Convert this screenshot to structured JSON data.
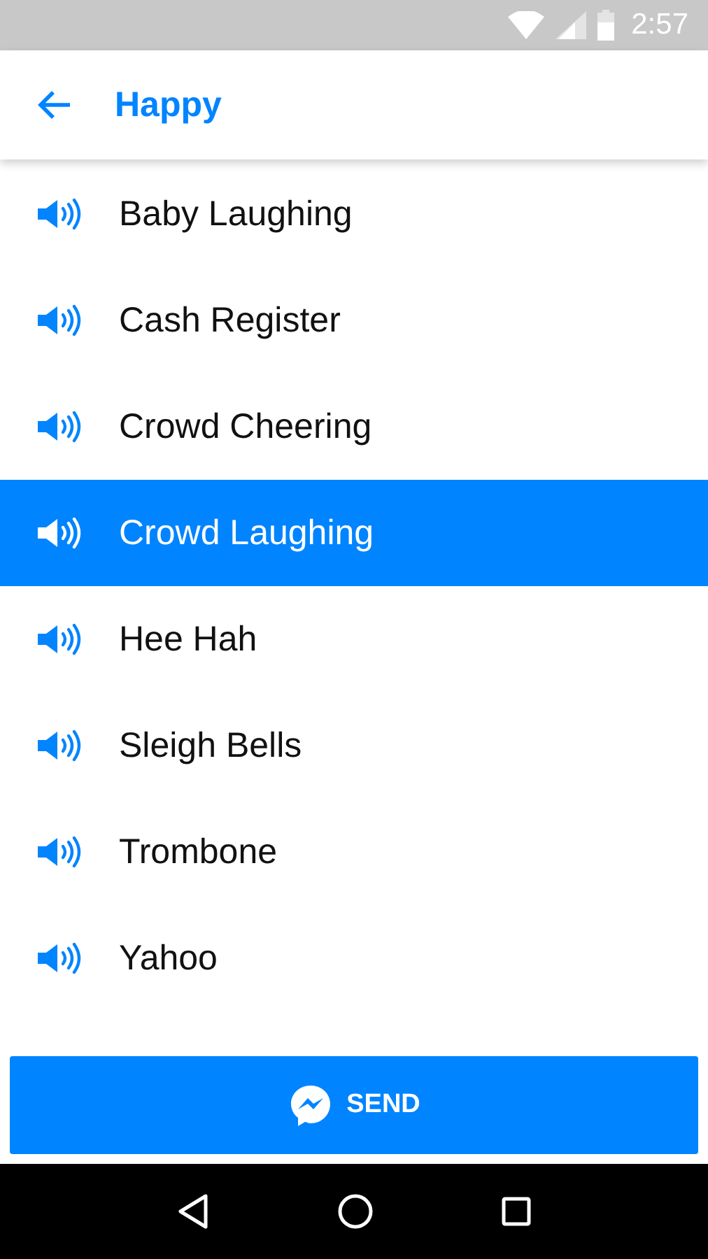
{
  "status_bar": {
    "time": "2:57"
  },
  "header": {
    "title": "Happy"
  },
  "sounds": [
    {
      "label": "Baby Laughing",
      "selected": false
    },
    {
      "label": "Cash Register",
      "selected": false
    },
    {
      "label": "Crowd Cheering",
      "selected": false
    },
    {
      "label": "Crowd Laughing",
      "selected": true
    },
    {
      "label": "Hee Hah",
      "selected": false
    },
    {
      "label": "Sleigh Bells",
      "selected": false
    },
    {
      "label": "Trombone",
      "selected": false
    },
    {
      "label": "Yahoo",
      "selected": false
    }
  ],
  "send_button": {
    "label": "SEND"
  }
}
